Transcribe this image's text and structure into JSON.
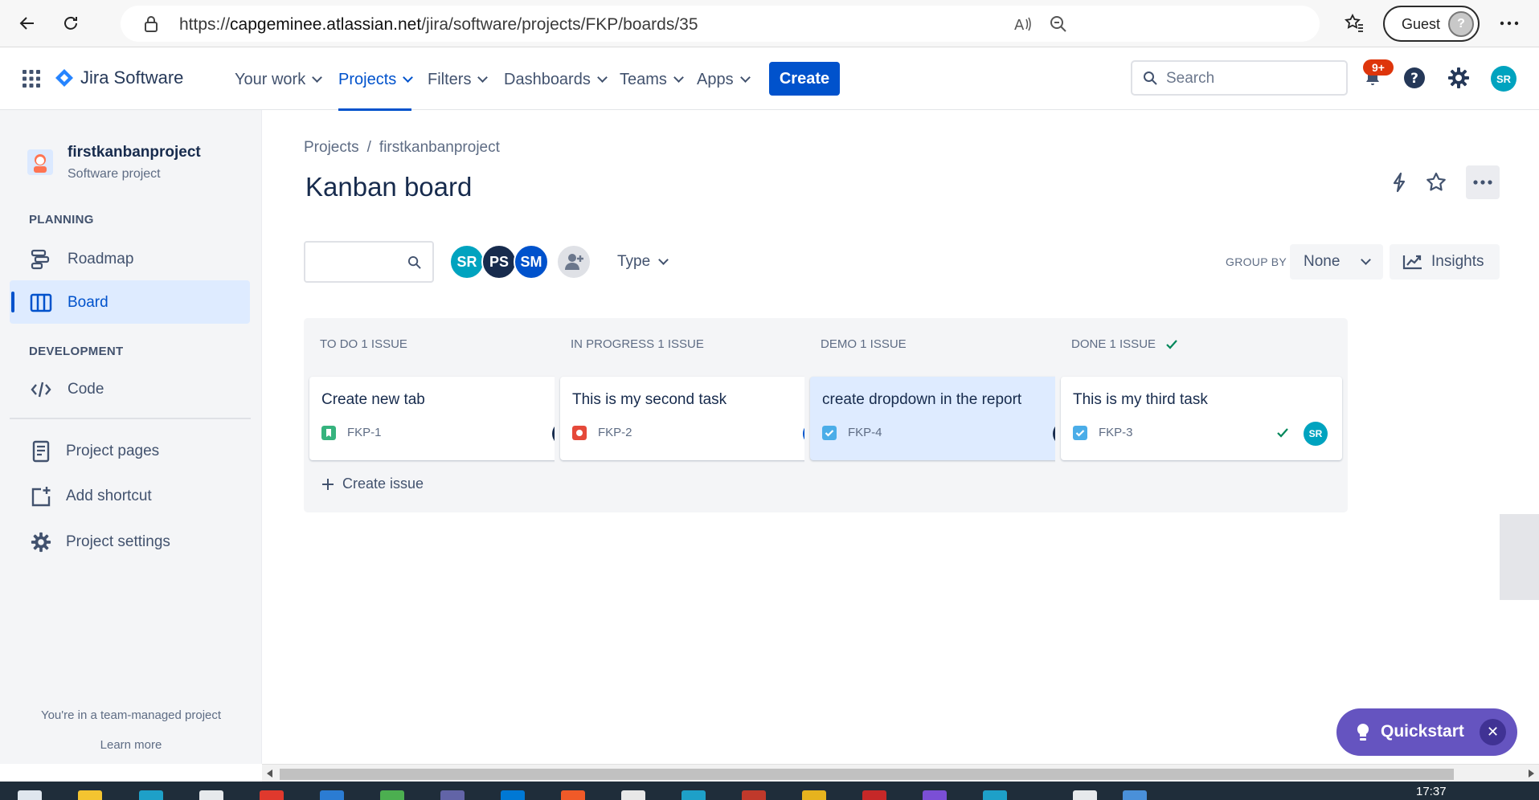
{
  "browser": {
    "url_prefix": "https://",
    "url_domain": "capgeminee.atlassian.net",
    "url_path": "/jira/software/projects/FKP/boards/35",
    "guest_label": "Guest"
  },
  "topnav": {
    "product": "Jira Software",
    "items": [
      "Your work",
      "Projects",
      "Filters",
      "Dashboards",
      "Teams",
      "Apps"
    ],
    "active": "Projects",
    "create_label": "Create",
    "search_placeholder": "Search",
    "notification_count": "9+",
    "user_initials": "SR"
  },
  "sidebar": {
    "project_name": "firstkanbanproject",
    "project_type": "Software project",
    "planning_heading": "PLANNING",
    "planning_items": [
      {
        "label": "Roadmap",
        "icon": "roadmap-icon"
      },
      {
        "label": "Board",
        "icon": "board-icon",
        "active": true
      }
    ],
    "development_heading": "DEVELOPMENT",
    "development_items": [
      {
        "label": "Code",
        "icon": "code-icon"
      }
    ],
    "other_items": [
      {
        "label": "Project pages",
        "icon": "pages-icon"
      },
      {
        "label": "Add shortcut",
        "icon": "add-shortcut-icon"
      },
      {
        "label": "Project settings",
        "icon": "settings-icon"
      }
    ],
    "footer_text": "You're in a team-managed project",
    "footer_link": "Learn more"
  },
  "main": {
    "breadcrumb": [
      "Projects",
      "firstkanbanproject"
    ],
    "title": "Kanban board",
    "filter_avatars": [
      {
        "initials": "SR",
        "color": "#00a3bf"
      },
      {
        "initials": "PS",
        "color": "#172b4d"
      },
      {
        "initials": "SM",
        "color": "#0052cc"
      }
    ],
    "type_filter_label": "Type",
    "group_by_label": "GROUP BY",
    "group_by_value": "None",
    "insights_label": "Insights"
  },
  "columns": [
    {
      "title": "TO DO 1 ISSUE",
      "done_check": false,
      "card": {
        "title": "Create new tab",
        "key": "FKP-1",
        "type": "story",
        "assignee": "PS",
        "assignee_color": "#172b4d",
        "highlight": false,
        "resolved": false
      },
      "create_issue_label": "Create issue"
    },
    {
      "title": "IN PROGRESS 1 ISSUE",
      "done_check": false,
      "card": {
        "title": "This is my second task",
        "key": "FKP-2",
        "type": "bug",
        "assignee": "SM",
        "assignee_color": "#0052cc",
        "highlight": false,
        "resolved": false
      }
    },
    {
      "title": "DEMO 1 ISSUE",
      "done_check": false,
      "card": {
        "title": "create dropdown in the report",
        "key": "FKP-4",
        "type": "task",
        "assignee": "PS",
        "assignee_color": "#172b4d",
        "highlight": true,
        "resolved": false
      }
    },
    {
      "title": "DONE 1 ISSUE",
      "done_check": true,
      "card": {
        "title": "This is my third task",
        "key": "FKP-3",
        "type": "task",
        "assignee": "SR",
        "assignee_color": "#00a3bf",
        "highlight": false,
        "resolved": true
      }
    }
  ],
  "quickstart": {
    "label": "Quickstart"
  },
  "taskbar": {
    "time": "17:37"
  },
  "colors": {
    "primary": "#0052cc",
    "quickstart": "#6554c0",
    "done_green": "#00875a"
  }
}
